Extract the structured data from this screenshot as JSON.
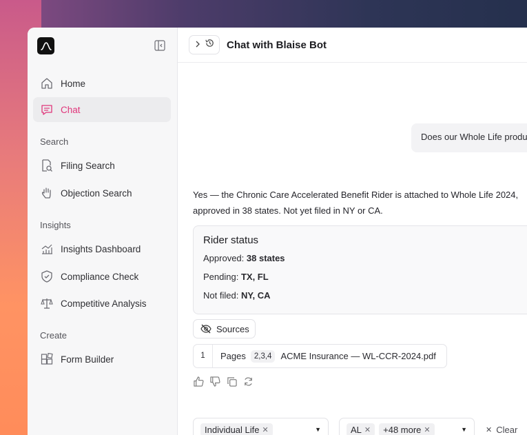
{
  "sidebar": {
    "items": [
      {
        "label": "Home",
        "icon": "home-icon"
      },
      {
        "label": "Chat",
        "icon": "chat-icon"
      },
      {
        "label": "Filing Search",
        "icon": "file-search-icon"
      },
      {
        "label": "Objection Search",
        "icon": "hand-icon"
      },
      {
        "label": "Insights Dashboard",
        "icon": "chart-icon"
      },
      {
        "label": "Compliance Check",
        "icon": "shield-icon"
      },
      {
        "label": "Competitive Analysis",
        "icon": "scale-icon"
      },
      {
        "label": "Form Builder",
        "icon": "blocks-icon"
      }
    ],
    "sections": {
      "search": "Search",
      "insights": "Insights",
      "create": "Create"
    },
    "active_item": "Chat"
  },
  "header": {
    "title": "Chat with Blaise Bot"
  },
  "chat": {
    "user_message": "Does our Whole Life produ",
    "bot_line1": "Yes — the Chronic Care Accelerated Benefit Rider is attached to Whole Life 2024,",
    "bot_line2": "approved in 38 states. Not yet filed in NY or CA.",
    "card": {
      "title": "Rider status",
      "approved_label": "Approved:",
      "approved_value": "38 states",
      "pending_label": "Pending:",
      "pending_value": "TX, FL",
      "notfiled_label": "Not filed:",
      "notfiled_value": "NY, CA"
    },
    "sources_label": "Sources",
    "source": {
      "num": "1",
      "pages_label": "Pages",
      "pages": "2,3,4",
      "file": "ACME Insurance — WL-CCR-2024.pdf"
    }
  },
  "filters": {
    "product_chip": "Individual Life",
    "state_chip": "AL",
    "more_chip": "+48 more",
    "clear_label": "Clear"
  },
  "colors": {
    "accent": "#e0357a"
  }
}
